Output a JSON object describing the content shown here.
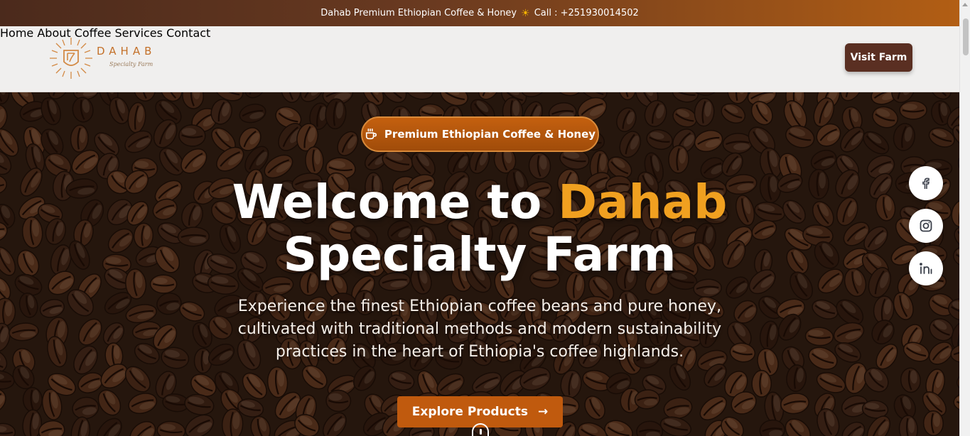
{
  "topbar": {
    "text": "Dahab Premium Ethiopian Coffee & Honey",
    "sun": "☀",
    "call": "Call : +251930014502"
  },
  "brand": {
    "name": "DAHAB",
    "tagline": "Specialty Farm",
    "color": "#c4712a"
  },
  "nav": {
    "items": [
      "Home",
      "About",
      "Coffee",
      "Services",
      "Contact"
    ],
    "cta": "Visit Farm"
  },
  "hero": {
    "badge": "Premium Ethiopian Coffee & Honey",
    "title_part1": "Welcome to ",
    "title_accent": "Dahab",
    "title_line2": "Specialty Farm",
    "subtitle": "Experience the finest Ethiopian coffee beans and pure honey, cultivated with traditional methods and modern sustainability practices in the heart of Ethiopia's coffee highlands.",
    "button": "Explore Products",
    "button_arrow": "→"
  },
  "social": {
    "facebook": "f",
    "instagram": "instagram-icon",
    "linkedin": "in"
  },
  "colors": {
    "accent": "#f0a020",
    "button": "#c05a0e",
    "navButton": "#5a2f22"
  }
}
